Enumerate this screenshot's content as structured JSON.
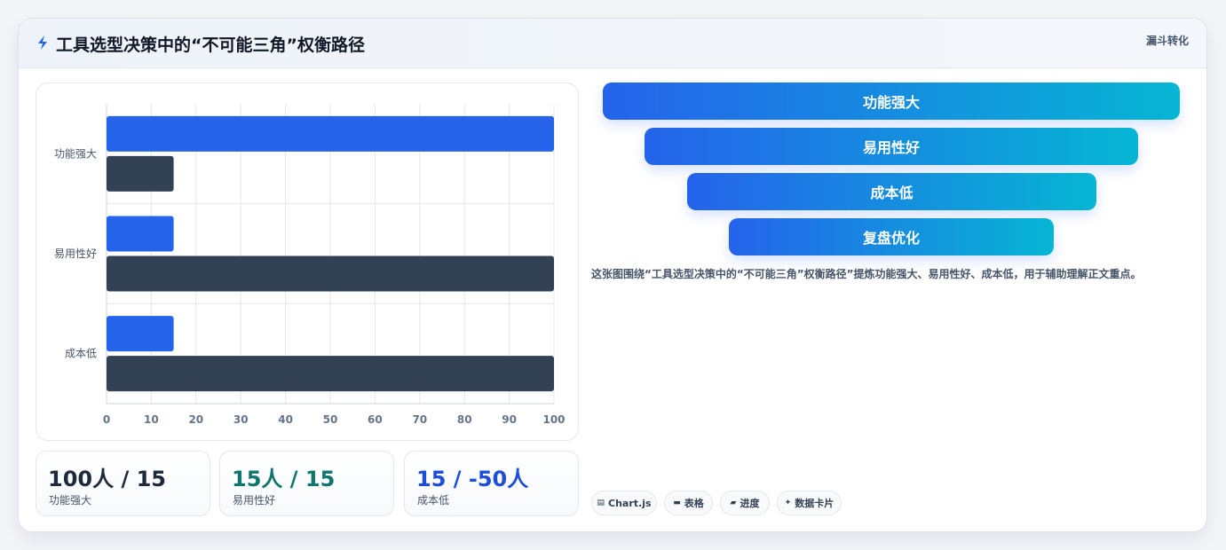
{
  "header": {
    "icon": "lightning-icon",
    "title": "工具选型决策中的“不可能三角”权衡路径",
    "tag": "漏斗转化"
  },
  "chart_data": {
    "type": "bar",
    "orientation": "horizontal",
    "categories": [
      "功能强大",
      "易用性好",
      "成本低"
    ],
    "series": [
      {
        "values": [
          100,
          15,
          15
        ],
        "color": "#2563eb"
      },
      {
        "values": [
          15,
          100,
          100
        ],
        "color": "#334155"
      }
    ],
    "x_ticks": [
      "0",
      "10",
      "20",
      "30",
      "40",
      "50",
      "60",
      "70",
      "80",
      "90",
      "100"
    ],
    "xlim": [
      0,
      100
    ],
    "grid": true,
    "legend": "none"
  },
  "stats": [
    {
      "value": "100人 / 15",
      "label": "功能强大",
      "color": "#1e293b"
    },
    {
      "value": "15人 / 15",
      "label": "易用性好",
      "color": "#0f766e"
    },
    {
      "value": "15 / -50人",
      "label": "成本低",
      "color": "#1d4ed8"
    }
  ],
  "funnel": {
    "stages": [
      "功能强大",
      "易用性好",
      "成本低",
      "复盘优化"
    ],
    "gradient": [
      "#2563eb",
      "#06b6d4"
    ]
  },
  "description": "这张图围绕“工具选型决策中的“不可能三角”权衡路径”提炼功能强大、易用性好、成本低，用于辅助理解正文重点。",
  "pills": [
    {
      "icon": "chart-icon",
      "label": "Chart.js"
    },
    {
      "icon": "table-icon",
      "label": "表格"
    },
    {
      "icon": "progress-icon",
      "label": "进度"
    },
    {
      "icon": "sparkle-icon",
      "label": "数据卡片"
    }
  ]
}
